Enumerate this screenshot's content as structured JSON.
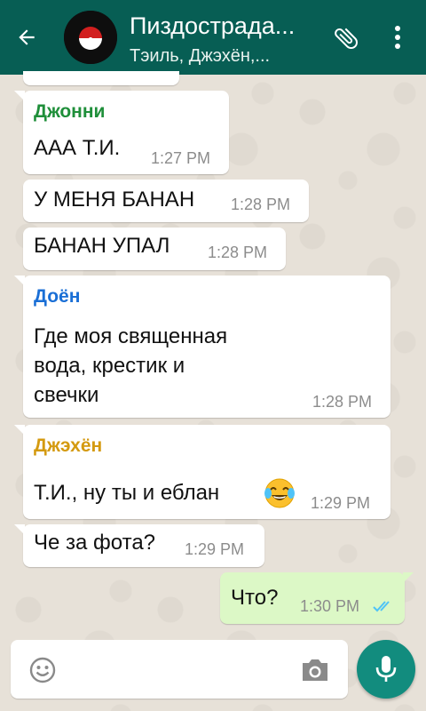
{
  "header": {
    "title": "Пиздострада...",
    "subtitle": "Тэиль, Джэхён,...",
    "bar_color": "#075e54"
  },
  "messages": [
    {
      "sender": "Джонни",
      "sender_color": "#1f8f3a",
      "lines": [
        "ААА Т.И."
      ],
      "time": "1:27 PM"
    },
    {
      "lines": [
        "У МЕНЯ БАНАН"
      ],
      "time": "1:28 PM"
    },
    {
      "lines": [
        "БАНАН УПАЛ"
      ],
      "time": "1:28 PM"
    },
    {
      "sender": "Доён",
      "sender_color": "#1a6fd6",
      "lines": [
        "Где моя священная",
        "вода, крестик и",
        "свечки"
      ],
      "time": "1:28 PM"
    },
    {
      "sender": "Джэхён",
      "sender_color": "#d49a10",
      "lines": [
        "Т.И., ну ты и еблан"
      ],
      "emoji": "face-with-tears-of-joy",
      "time": "1:29 PM"
    },
    {
      "lines": [
        "Че за фота?"
      ],
      "time": "1:29 PM"
    },
    {
      "lines": [
        "Что?"
      ],
      "time": "1:30 PM",
      "outgoing": true,
      "status": "read-double-check"
    }
  ],
  "input": {
    "placeholder": ""
  },
  "colors": {
    "outgoing_bubble": "#dcf8c6",
    "incoming_bubble": "#ffffff",
    "read_check": "#4fc3f7",
    "mic_button": "#128c7e"
  },
  "icons": [
    "back-arrow-icon",
    "avatar-icon",
    "paperclip-icon",
    "more-vert-icon",
    "emoji-icon",
    "camera-icon",
    "mic-icon",
    "double-check-icon"
  ]
}
